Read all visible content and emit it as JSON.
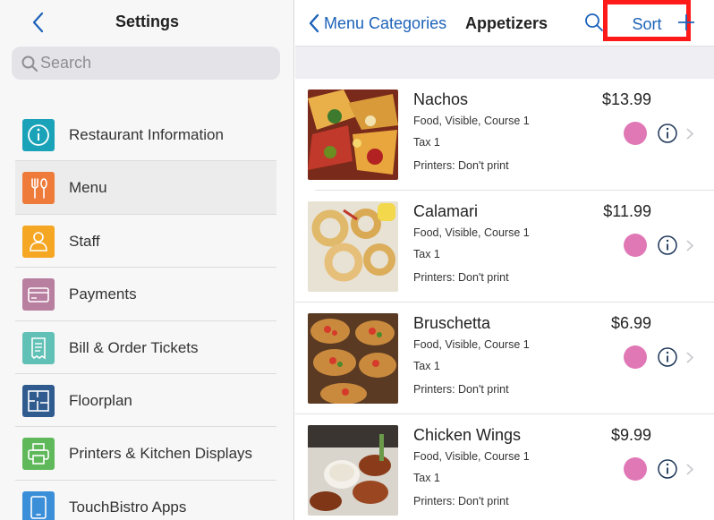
{
  "left": {
    "title": "Settings",
    "search_placeholder": "Search",
    "items": [
      {
        "label": "Restaurant Information",
        "icon": "info-icon",
        "color": "#1aa3b8"
      },
      {
        "label": "Menu",
        "icon": "fork-knife-icon",
        "color": "#ef7b3a",
        "active": true
      },
      {
        "label": "Staff",
        "icon": "person-icon",
        "color": "#f5a623"
      },
      {
        "label": "Payments",
        "icon": "card-icon",
        "color": "#b97fa0"
      },
      {
        "label": "Bill & Order Tickets",
        "icon": "receipt-icon",
        "color": "#62c1b6"
      },
      {
        "label": "Floorplan",
        "icon": "floorplan-icon",
        "color": "#2f5b8f"
      },
      {
        "label": "Printers & Kitchen Displays",
        "icon": "printer-icon",
        "color": "#5fb95a"
      },
      {
        "label": "TouchBistro Apps",
        "icon": "tablet-icon",
        "color": "#3a8fd8"
      }
    ]
  },
  "right": {
    "back_label": "Menu Categories",
    "title": "Appetizers",
    "sort_label": "Sort",
    "items": [
      {
        "name": "Nachos",
        "price": "$13.99",
        "meta": "Food, Visible, Course 1",
        "tax": "Tax 1",
        "printers": "Printers: Don't print",
        "dot_color": "#e078b6"
      },
      {
        "name": "Calamari",
        "price": "$11.99",
        "meta": "Food, Visible, Course 1",
        "tax": "Tax 1",
        "printers": "Printers: Don't print",
        "dot_color": "#e078b6"
      },
      {
        "name": "Bruschetta",
        "price": "$6.99",
        "meta": "Food, Visible, Course 1",
        "tax": "Tax 1",
        "printers": "Printers: Don't print",
        "dot_color": "#e078b6"
      },
      {
        "name": "Chicken Wings",
        "price": "$9.99",
        "meta": "Food, Visible, Course 1",
        "tax": "Tax 1",
        "printers": "Printers: Don't print",
        "dot_color": "#e078b6"
      }
    ]
  },
  "colors": {
    "accent_blue": "#1c62b9",
    "highlight_red": "#ff1a1a"
  }
}
